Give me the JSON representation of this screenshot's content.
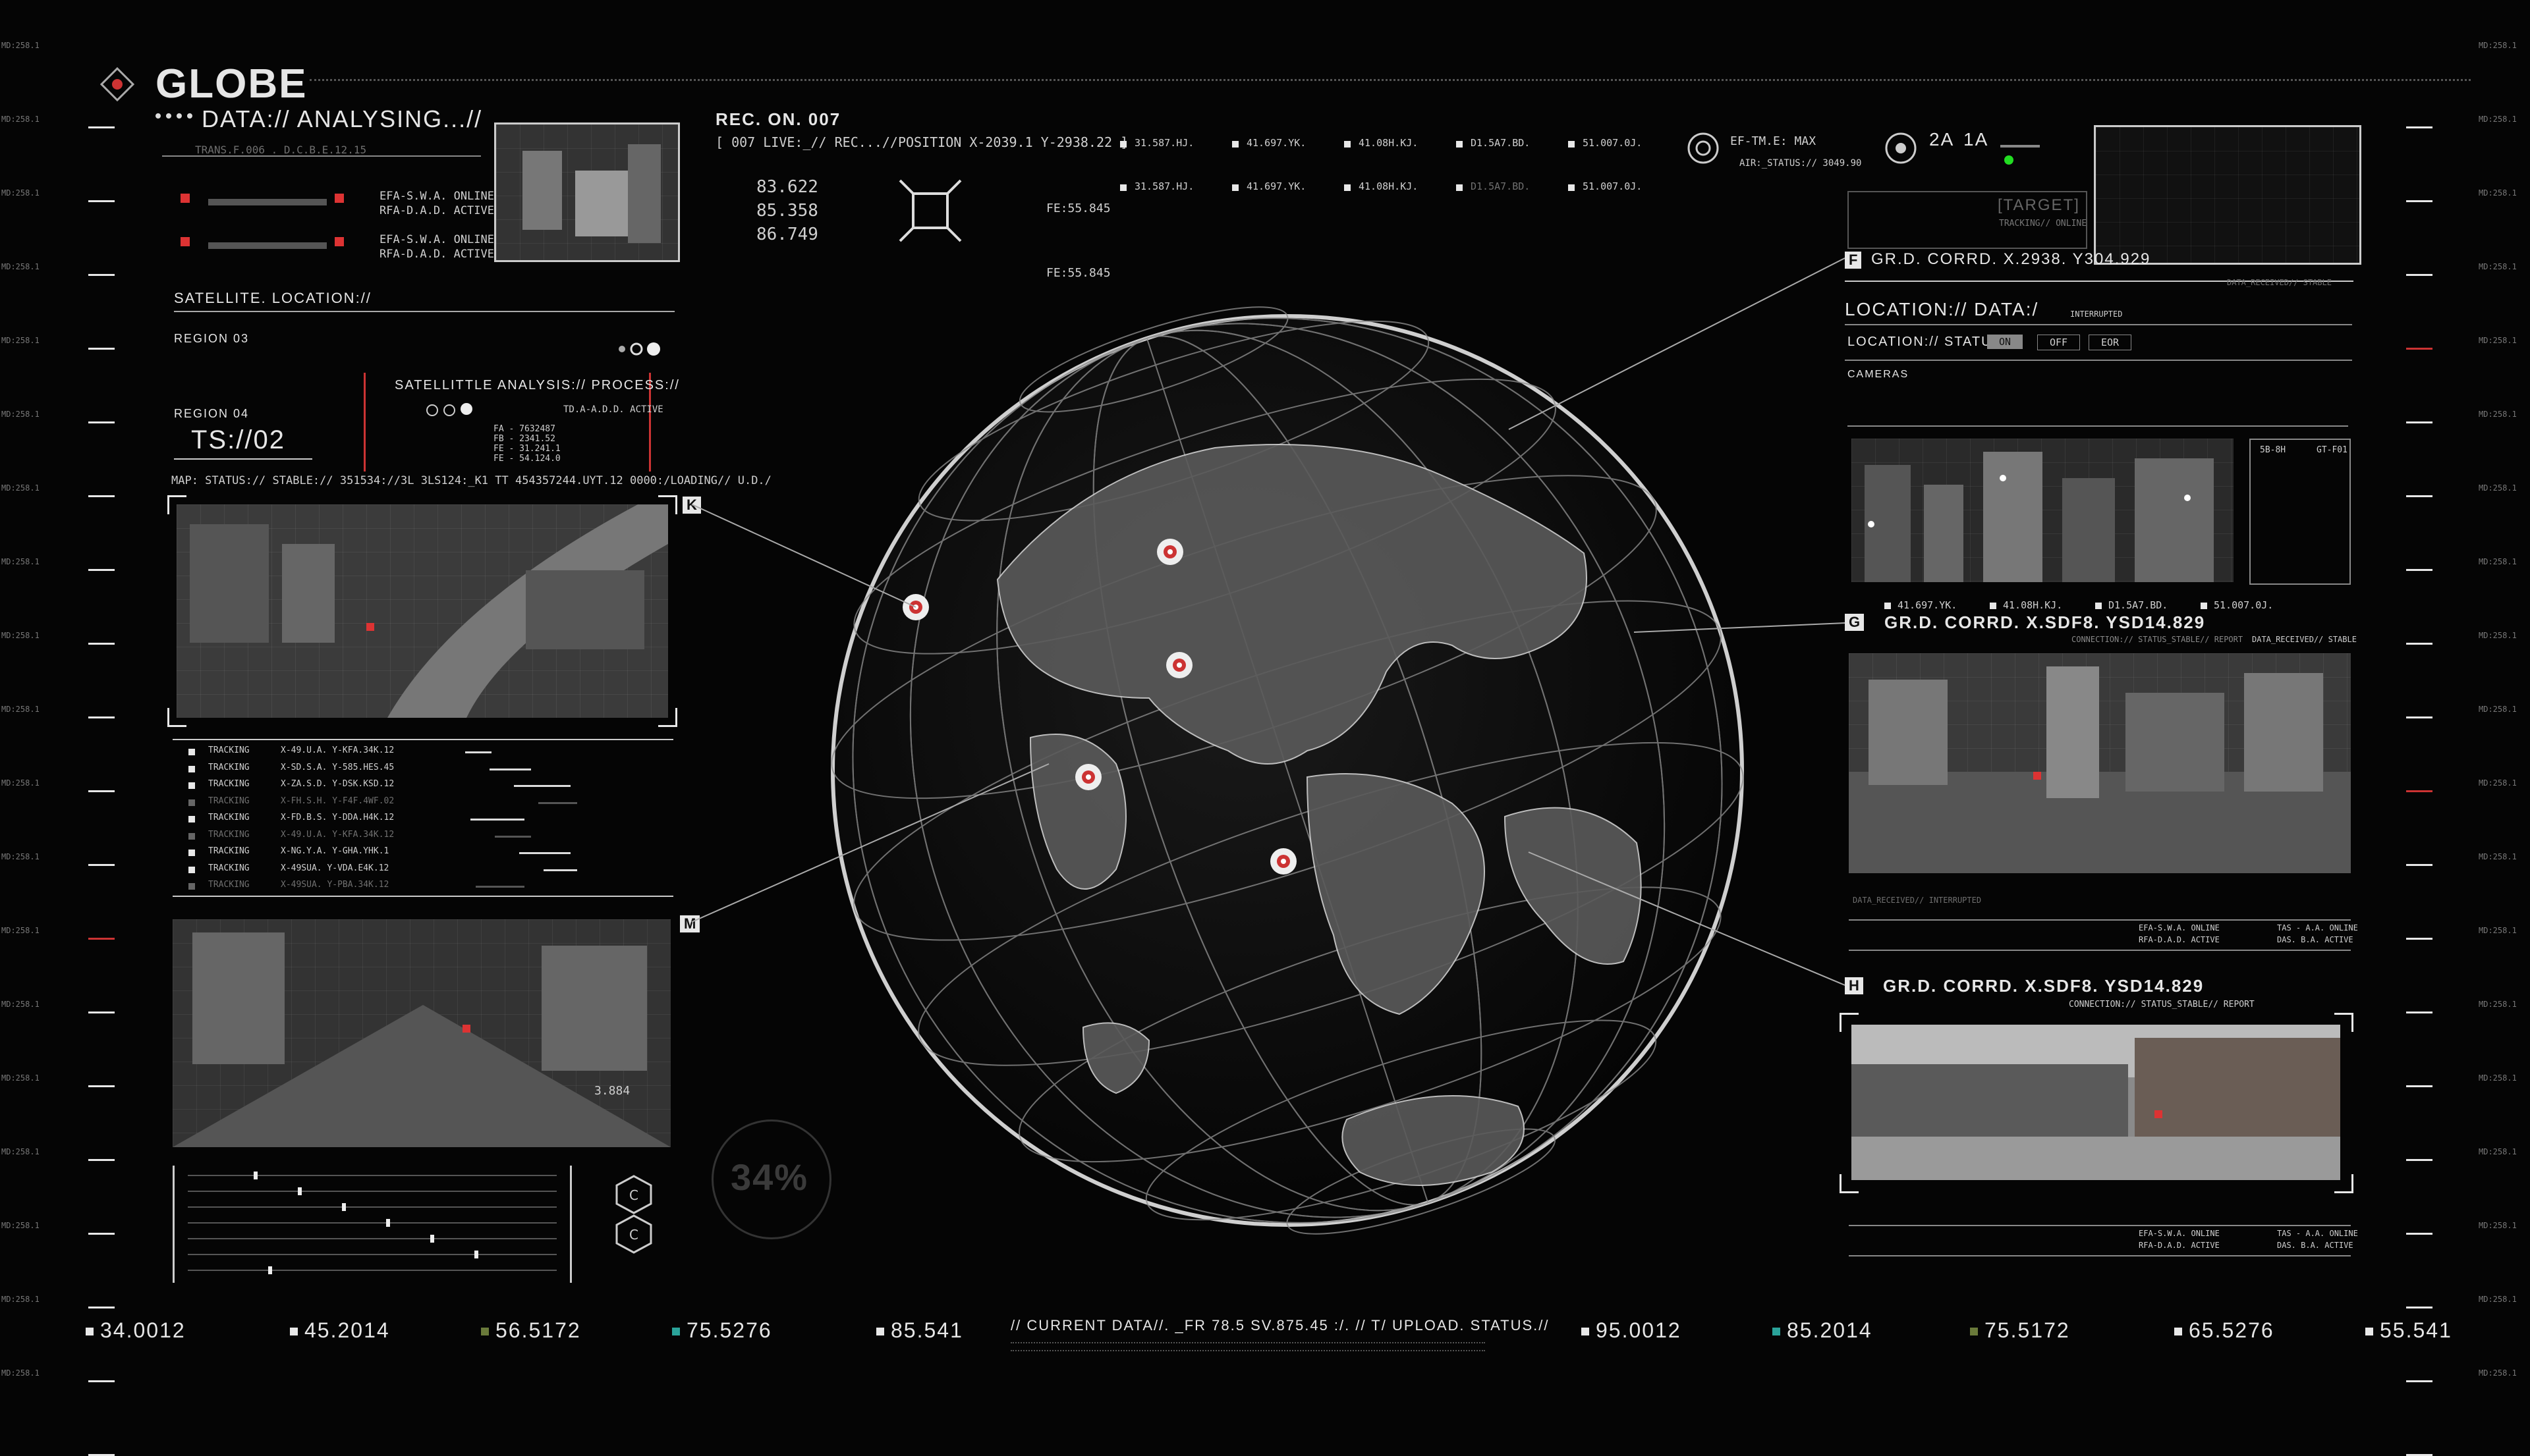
{
  "header": {
    "title": "GLOBE",
    "subtitle": "DATA:// ANALYSING...//",
    "rec": "REC. ON. 007",
    "live": "[ 007   LIVE:_//  REC...//POSITION   X-2039.1  Y-2938.22 ]",
    "status_lines": [
      "EFA-S.W.A. ONLINE",
      "RFA-D.A.D. ACTIVE",
      "EFA-S.W.A. ONLINE",
      "RFA-D.A.D. ACTIVE"
    ],
    "top_values": [
      "31.587.HJ.",
      "41.697.YK.",
      "41.08H.KJ.",
      "D1.5A7.BD.",
      "51.007.0J."
    ],
    "coords": [
      "83.622",
      "85.358",
      "86.749"
    ],
    "fe": [
      "FE:55.845",
      "FE:55.845"
    ],
    "ef_tm": "EF-TM.E: MAX",
    "air_status": "AIR:_STATUS:// 3049.90",
    "mode_a": "2A",
    "mode_b": "1A"
  },
  "left": {
    "satellite_location": "SATELLITE. LOCATION://",
    "region_03": "REGION 03",
    "region_04": "REGION 04",
    "ts": "TS://02",
    "analysis_title": "SATELLITTLE ANALYSIS:// PROCESS://",
    "analysis_status": "TD.A-A.D.D. ACTIVE",
    "analysis_values": [
      "FA - 7632487",
      "FB - 2341.52",
      "FE - 31.241.1",
      "FE - 54.124.0"
    ],
    "map_status": "MAP: STATUS:// STABLE://   351534://3L   3LS124:_K1   TT   454357244.UYT.12      0000:/LOADING// U.D./",
    "feed_k": "K",
    "feed_m": "M",
    "tracking": [
      {
        "label": "TRACKING",
        "code": "X-49.U.A. Y-KFA.34K.12"
      },
      {
        "label": "TRACKING",
        "code": "X-SD.S.A. Y-585.HES.45"
      },
      {
        "label": "TRACKING",
        "code": "X-ZA.S.D. Y-DSK.KSD.12"
      },
      {
        "label": "TRACKING",
        "code": "X-FH.S.H. Y-F4F.4WF.02"
      },
      {
        "label": "TRACKING",
        "code": "X-FD.B.S. Y-DDA.H4K.12"
      },
      {
        "label": "TRACKING",
        "code": "X-49.U.A. Y-KFA.34K.12"
      },
      {
        "label": "TRACKING",
        "code": "X-NG.Y.A. Y-GHA.YHK.1"
      },
      {
        "label": "TRACKING",
        "code": "X-49SUA. Y-VDA.E4K.12"
      },
      {
        "label": "TRACKING",
        "code": "X-49SUA. Y-PBA.34K.12"
      }
    ],
    "feed_value": "3.884",
    "icon_c": "C"
  },
  "center": {
    "percent": "34%",
    "current_data": "// CURRENT DATA//. _FR 78.5  SV.875.45  :/. // T/ UPLOAD. STATUS.//"
  },
  "right": {
    "target": "[TARGET]",
    "tracking_online": "TRACKING// ONLINE",
    "corr_f": "GR.D. CORRD. X.2938. Y304.929",
    "corr_g": "GR.D. CORRD. X.SDF8. YSD14.829",
    "corr_h": "GR.D. CORRD. X.SDF8. YSD14.829",
    "label_f": "F",
    "label_g": "G",
    "label_h": "H",
    "location_data": "LOCATION:// DATA:/",
    "interrupted": "INTERRUPTED",
    "location_status": "LOCATION:// STATUS...",
    "btn_on": "ON",
    "btn_off": "OFF",
    "btn_eor": "EOR",
    "cameras": "CAMERAS",
    "mid_values": [
      "41.697.YK.",
      "41.08H.KJ.",
      "D1.5A7.BD.",
      "51.007.0J."
    ],
    "connection": "CONNECTION:// STATUS_STABLE// REPORT",
    "data_received": "DATA_RECEIVED// STABLE",
    "data_received_int": "DATA_RECEIVED// INTERRUPTED",
    "panel_codes": [
      "5B-8H",
      "GT-F01"
    ],
    "status_lines": [
      "EFA-S.W.A. ONLINE",
      "RFA-D.A.D. ACTIVE",
      "TAS - A.A. ONLINE",
      "DAS. B.A. ACTIVE"
    ]
  },
  "footer": {
    "values": [
      "34.0012",
      "45.2014",
      "56.5172",
      "75.5276",
      "85.541",
      "95.0012",
      "85.2014",
      "75.5172",
      "65.5276",
      "55.541"
    ],
    "colors": [
      "#e8e8e8",
      "#e8e8e8",
      "#6a7a3a",
      "#2aa39a",
      "#e8e8e8",
      "#e8e8e8",
      "#2aa39a",
      "#6a7a3a",
      "#e8e8e8",
      "#e8e8e8"
    ]
  },
  "side_labels": [
    "MD:258.1",
    "MD:258.1",
    "MD:258.1",
    "MD:258.1",
    "MD:258.1",
    "MD:258.1",
    "MD:258.1",
    "MD:258.1",
    "MD:258.1",
    "MD:258.1",
    "MD:258.1",
    "MD:258.1",
    "MD:258.1",
    "MD:258.1",
    "MD:258.1",
    "MD:258.1",
    "MD:258.1",
    "MD:258.1",
    "MD:258.1"
  ],
  "markers": [
    {
      "name": "marker-1",
      "lat": 1
    },
    {
      "name": "marker-2",
      "lat": 2
    },
    {
      "name": "marker-3",
      "lat": 3
    },
    {
      "name": "marker-4",
      "lat": 4
    },
    {
      "name": "marker-5",
      "lat": 5
    }
  ]
}
